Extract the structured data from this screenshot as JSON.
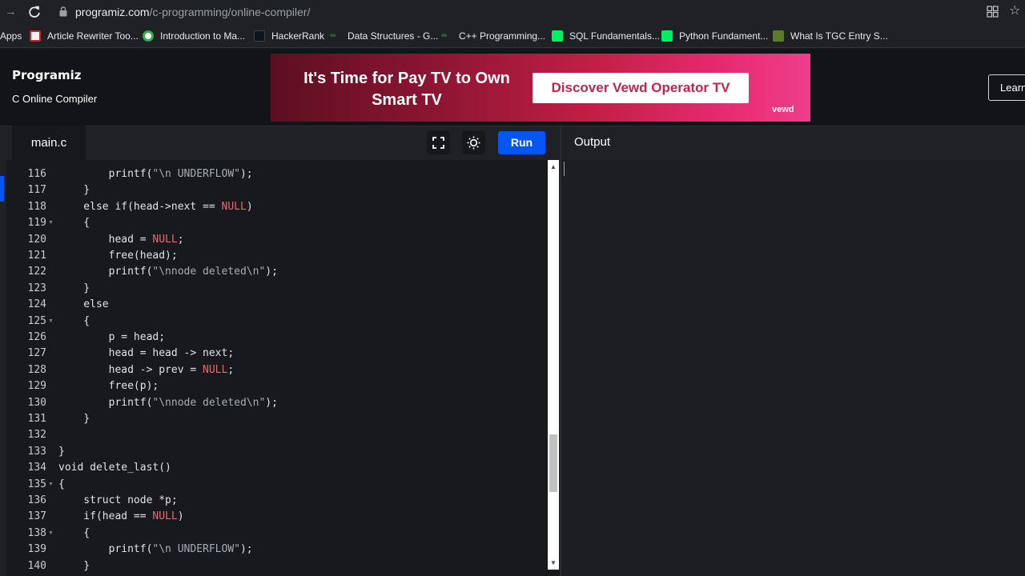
{
  "browser": {
    "url_host": "programiz.com",
    "url_path": "/c-programming/online-compiler/"
  },
  "bookmarks": [
    {
      "label": "Apps",
      "icon": "apps-icon"
    },
    {
      "label": "Article Rewriter Too...",
      "icon": "article-rewriter-favicon"
    },
    {
      "label": "Introduction to Ma...",
      "icon": "google-favicon"
    },
    {
      "label": "HackerRank",
      "icon": "hackerrank-favicon"
    },
    {
      "label": "Data Structures - G...",
      "icon": "gfg-favicon"
    },
    {
      "label": "C++ Programming...",
      "icon": "gfg-favicon"
    },
    {
      "label": "SQL Fundamentals...",
      "icon": "datacamp-favicon"
    },
    {
      "label": "Python Fundament...",
      "icon": "datacamp-favicon"
    },
    {
      "label": "What Is TGC Entry S...",
      "icon": "tgc-favicon"
    }
  ],
  "header": {
    "logo": "Programiz",
    "subtitle": "C Online Compiler",
    "learn_button": "Learn"
  },
  "ad": {
    "headline": "It's Time for Pay TV to Own Smart TV",
    "cta": "Discover Vewd Operator TV",
    "brand": "vewd"
  },
  "editor": {
    "tab": "main.c",
    "run_label": "Run",
    "lines": [
      {
        "n": "116",
        "code": "        printf(\"\\n UNDERFLOW\");"
      },
      {
        "n": "117",
        "code": "    }"
      },
      {
        "n": "118",
        "code": "    else if(head->next == NULL)"
      },
      {
        "n": "119",
        "code": "    {"
      },
      {
        "n": "120",
        "code": "        head = NULL;"
      },
      {
        "n": "121",
        "code": "        free(head);"
      },
      {
        "n": "122",
        "code": "        printf(\"\\nnode deleted\\n\");"
      },
      {
        "n": "123",
        "code": "    }"
      },
      {
        "n": "124",
        "code": "    else"
      },
      {
        "n": "125",
        "code": "    {"
      },
      {
        "n": "126",
        "code": "        p = head;"
      },
      {
        "n": "127",
        "code": "        head = head -> next;"
      },
      {
        "n": "128",
        "code": "        head -> prev = NULL;"
      },
      {
        "n": "129",
        "code": "        free(p);"
      },
      {
        "n": "130",
        "code": "        printf(\"\\nnode deleted\\n\");"
      },
      {
        "n": "131",
        "code": "    }"
      },
      {
        "n": "132",
        "code": ""
      },
      {
        "n": "133",
        "code": "}"
      },
      {
        "n": "134",
        "code": "void delete_last()"
      },
      {
        "n": "135",
        "code": "{"
      },
      {
        "n": "136",
        "code": "    struct node *p;"
      },
      {
        "n": "137",
        "code": "    if(head == NULL)"
      },
      {
        "n": "138",
        "code": "    {"
      },
      {
        "n": "139",
        "code": "        printf(\"\\n UNDERFLOW\");"
      },
      {
        "n": "140",
        "code": "    }"
      }
    ],
    "fold_lines": [
      "119",
      "125",
      "135",
      "138"
    ]
  },
  "output": {
    "label": "Output"
  },
  "colors": {
    "run_button": "#0556f3",
    "editor_bg": "#17191c",
    "null_keyword": "#e06c75"
  }
}
